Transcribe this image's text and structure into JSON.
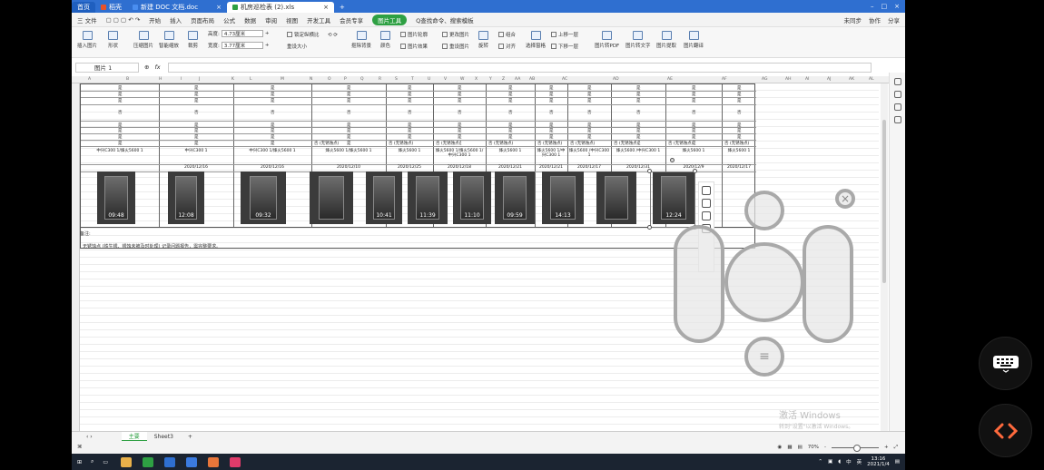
{
  "titlebar": {
    "tabs": [
      {
        "label": "首页",
        "kind": "home"
      },
      {
        "label": "稻壳",
        "kind": "plain"
      },
      {
        "label": "新建 DOC 文档.doc",
        "kind": "plain"
      },
      {
        "label": "机房巡检表 (2).xls",
        "kind": "active"
      }
    ],
    "add_label": "+"
  },
  "menubar": {
    "file": "三 文件",
    "items": [
      "开始",
      "插入",
      "页面布局",
      "公式",
      "数据",
      "审阅",
      "视图",
      "开发工具",
      "会员专享"
    ],
    "active_tool": "图片工具",
    "search": "Q查找命令、搜索模板",
    "right": [
      "未同步",
      "协作",
      "分享"
    ]
  },
  "ribbon": {
    "buttons": [
      "插入图片",
      "形状",
      "压缩图片",
      "智能缩放",
      "裁剪",
      "抠除背景",
      "颜色",
      "旋转",
      "选择窗格",
      "图片转PDF",
      "图片转文字",
      "图片提取",
      "图片翻译"
    ],
    "height_label": "高度:",
    "height_value": "4.73厘米",
    "width_label": "宽度:",
    "width_value": "3.77厘米",
    "lock_ratio": "锁定纵横比",
    "reset_size": "重设大小",
    "outline": "图片轮廓",
    "change_pic": "更改图片",
    "effects": "图片效果",
    "reset_pic": "重设图片",
    "combine": "组合",
    "align": "对齐",
    "up_layer": "上移一层",
    "down_layer": "下移一层"
  },
  "formula_bar": {
    "name_box": "图片 1",
    "fx": "fx"
  },
  "column_headers": [
    "A",
    "B",
    "H",
    "I",
    "J",
    "K",
    "L",
    "M",
    "N",
    "O",
    "P",
    "Q",
    "R",
    "S",
    "T",
    "U",
    "V",
    "W",
    "X",
    "Y",
    "Z",
    "AA",
    "AB",
    "AC",
    "AD",
    "AE",
    "AF",
    "AG",
    "AH",
    "AI",
    "AJ",
    "AK",
    "AL"
  ],
  "table": {
    "check_rows": [
      "是",
      "是",
      "是",
      "否",
      "是",
      "是",
      "是",
      "是",
      "是"
    ],
    "footer_row": "否 (无锈蚀点)",
    "models": [
      "中兴C300 1/烽火5600 1",
      "中兴C300 1",
      "中兴C300 1/烽火5600 1",
      "烽火5600 1/烽火5600 1",
      "烽火5600 1",
      "烽火5600 1/烽火5600 1/中兴C300 1",
      "烽火5600 1",
      "烽火5600 1/中兴C300 1",
      "烽火5600 /中兴C300 1",
      "烽火5600 /中兴C300 1",
      "烽火5600 1",
      "烽火5600 1"
    ],
    "dates": [
      "2020/12/16",
      "2020/12/16",
      "2020/12/10",
      "2020/12/25",
      "2020/12/18",
      "2020/12/21",
      "2020/12/21",
      "2020/12/17",
      "2020/12/31",
      "2020/12/9",
      "2020/12/17"
    ],
    "photo_times": [
      "09:48",
      "12:08",
      "09:32",
      "",
      "10:41",
      "11:39",
      "11:10",
      "09:59",
      "14:13",
      "",
      "12:24"
    ],
    "remark_label": "备注:",
    "note": "无锈蚀点 (铁生锈、锈蚀未被及时处理) 记录问题报告，需完整要求。"
  },
  "sheets": {
    "tabs": [
      "主要",
      "Sheet3"
    ],
    "active": "主要",
    "add": "+"
  },
  "status": {
    "zoom": "70%",
    "zoom_minus": "-",
    "zoom_plus": "+"
  },
  "taskbar": {
    "tray": [
      "中",
      "英"
    ],
    "time": "13:16",
    "date": "2021/1/4"
  },
  "watermark": {
    "line1": "激活 Windows",
    "line2": "转到\"设置\"以激活 Windows。"
  },
  "colors": {
    "title_blue": "#2f6fd0",
    "accent_green": "#2ea043",
    "taskbar": "#1b2431"
  }
}
